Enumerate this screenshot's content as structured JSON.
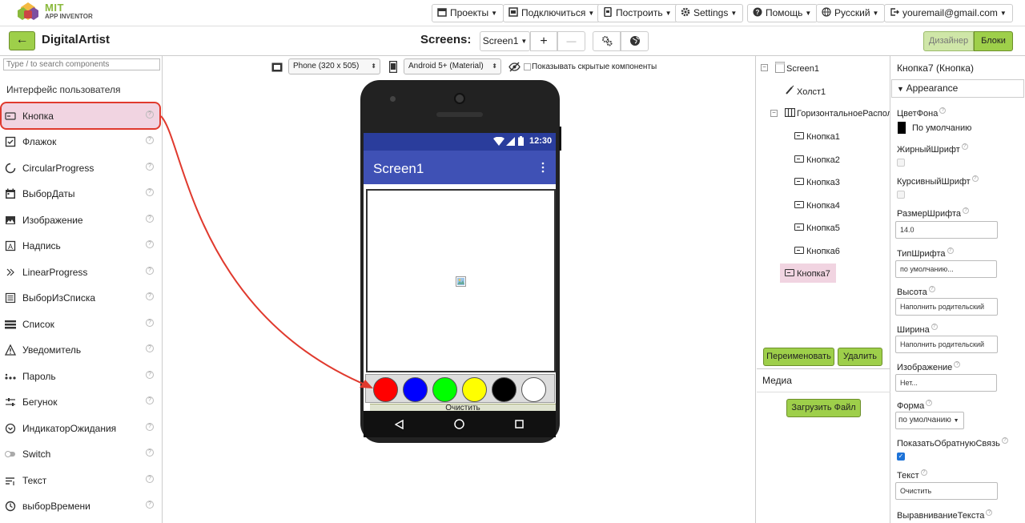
{
  "logo": {
    "mit": "MIT",
    "app_inventor": "APP INVENTOR"
  },
  "topmenu": {
    "projects": "Проекты",
    "connect": "Подключиться",
    "build": "Построить",
    "settings": "Settings",
    "help": "Помощь",
    "language": "Русский",
    "account": "youremail@gmail.com"
  },
  "toolbar": {
    "back": "←",
    "project_name": "DigitalArtist",
    "screens_label": "Screens:",
    "screen_select": "Screen1",
    "add_screen": "+",
    "remove_screen": "—",
    "designer": "Дизайнер",
    "blocks": "Блоки"
  },
  "palette": {
    "search_placeholder": "Type / to search components",
    "category": "Интерфейс пользователя",
    "items": [
      {
        "label": "Кнопка",
        "icon": "button-icon"
      },
      {
        "label": "Флажок",
        "icon": "checkbox-icon"
      },
      {
        "label": "CircularProgress",
        "icon": "circular-progress-icon"
      },
      {
        "label": "ВыборДаты",
        "icon": "calendar-icon"
      },
      {
        "label": "Изображение",
        "icon": "image-icon"
      },
      {
        "label": "Надпись",
        "icon": "label-icon"
      },
      {
        "label": "LinearProgress",
        "icon": "linear-progress-icon"
      },
      {
        "label": "ВыборИзСписка",
        "icon": "listpicker-icon"
      },
      {
        "label": "Список",
        "icon": "listview-icon"
      },
      {
        "label": "Уведомитель",
        "icon": "warning-icon"
      },
      {
        "label": "Пароль",
        "icon": "password-icon"
      },
      {
        "label": "Бегунок",
        "icon": "slider-icon"
      },
      {
        "label": "ИндикаторОжидания",
        "icon": "spinner-icon"
      },
      {
        "label": "Switch",
        "icon": "switch-icon"
      },
      {
        "label": "Текст",
        "icon": "textbox-icon"
      },
      {
        "label": "выборВремени",
        "icon": "clock-icon"
      }
    ],
    "help_glyph": "?"
  },
  "viewer": {
    "device_select": "Phone (320 x 505)",
    "theme_select": "Android 5+ (Material)",
    "hidden_label": "Показывать скрытые компоненты",
    "status_time": "12:30",
    "screen_title": "Screen1",
    "clear_button": "Очистить",
    "color_buttons": [
      "#ff0000",
      "#0000ff",
      "#00ff00",
      "#ffff00",
      "#000000",
      "#ffffff"
    ]
  },
  "tree": {
    "nodes": [
      {
        "label": "Screen1"
      },
      {
        "label": "Холст1"
      },
      {
        "label": "ГоризонтальноеРасположение1"
      },
      {
        "label": "Кнопка1"
      },
      {
        "label": "Кнопка2"
      },
      {
        "label": "Кнопка3"
      },
      {
        "label": "Кнопка4"
      },
      {
        "label": "Кнопка5"
      },
      {
        "label": "Кнопка6"
      },
      {
        "label": "Кнопка7"
      }
    ],
    "rename": "Переименовать",
    "delete": "Удалить",
    "media": "Медиа",
    "upload": "Загрузить Файл"
  },
  "properties": {
    "title": "Кнопка7 (Кнопка)",
    "section": "Appearance",
    "bgcolor_label": "ЦветФона",
    "bgcolor_value": "По умолчанию",
    "bold_label": "ЖирныйШрифт",
    "italic_label": "КурсивныйШрифт",
    "fontsize_label": "РазмерШрифта",
    "fontsize_value": "14.0",
    "typeface_label": "ТипШрифта",
    "typeface_value": "по умолчанию...",
    "height_label": "Высота",
    "height_value": "Наполнить родительский",
    "width_label": "Ширина",
    "width_value": "Наполнить родительский",
    "image_label": "Изображение",
    "image_value": "Нет...",
    "shape_label": "Форма",
    "shape_value": "по умолчанию",
    "feedback_label": "ПоказатьОбратнуюСвязь",
    "feedback_checked": true,
    "text_label": "Текст",
    "text_value": "Очистить",
    "align_label": "ВыравниваниеТекста"
  },
  "colors": {
    "accent_green": "#9ecf4a",
    "highlight_pink": "#f1d4e1",
    "arrow_red": "#e03a2e",
    "app_bar": "#3f51b5"
  }
}
